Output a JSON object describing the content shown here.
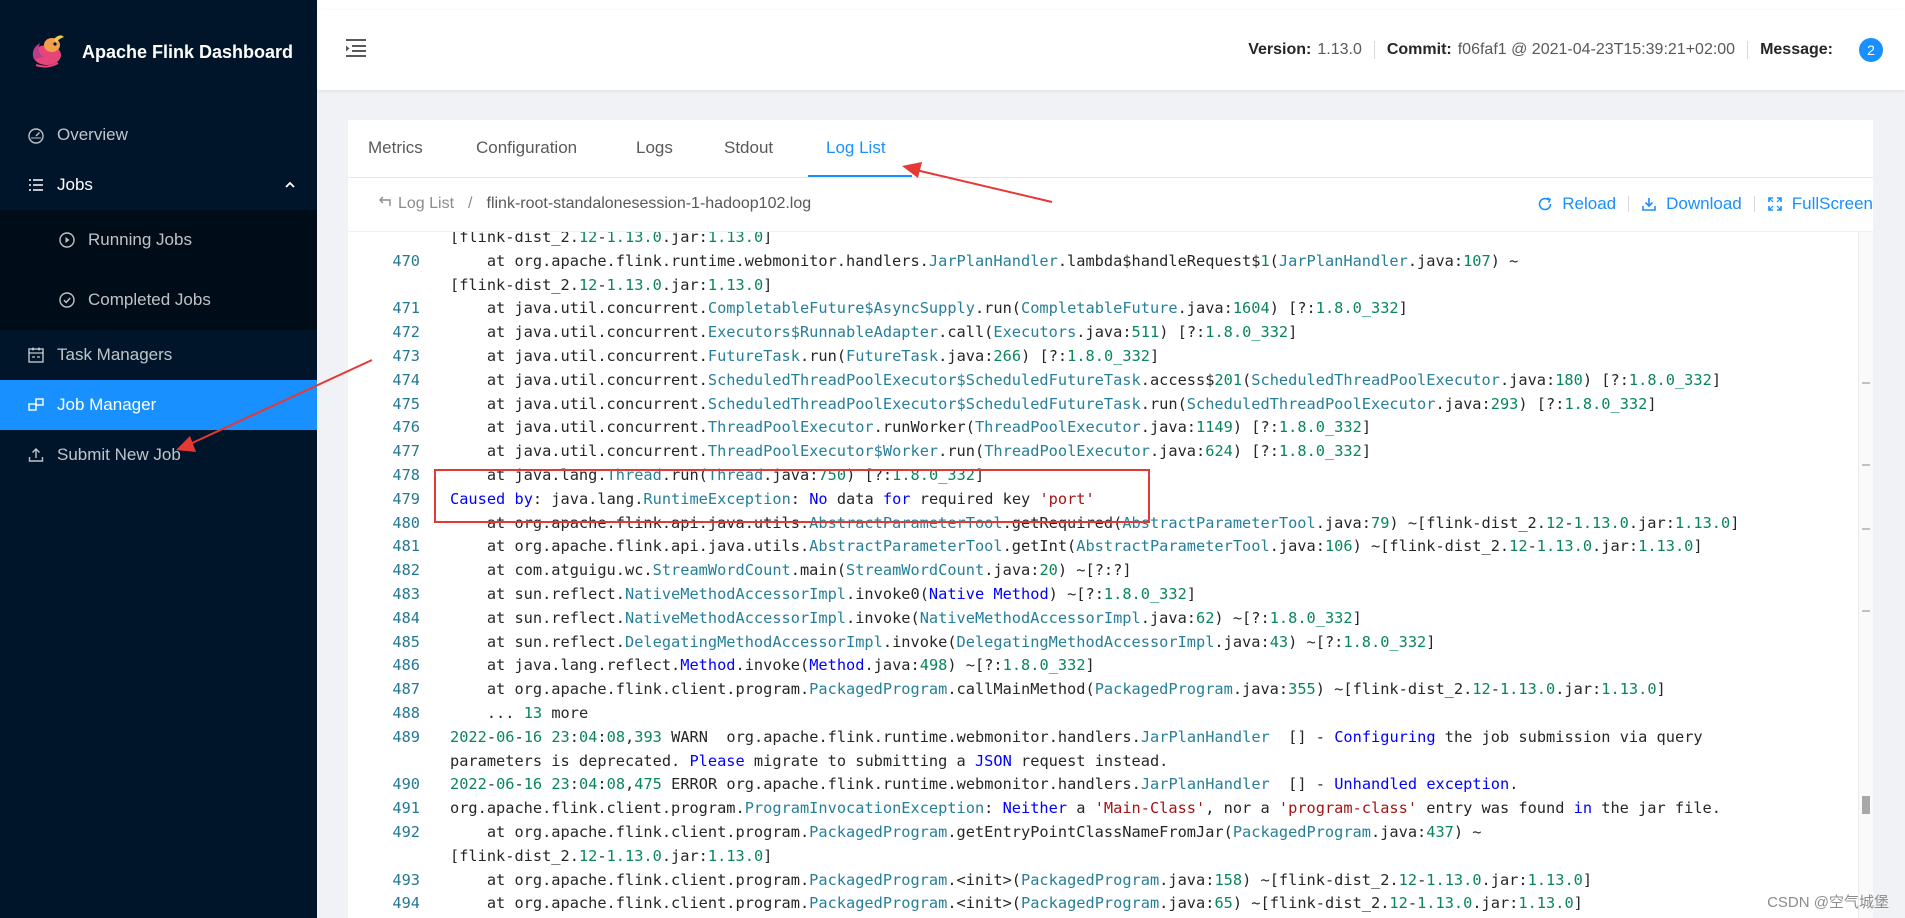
{
  "brand": {
    "title": "Apache Flink Dashboard"
  },
  "sidebar": {
    "items": [
      {
        "label": "Overview"
      },
      {
        "label": "Jobs"
      },
      {
        "label": "Running Jobs"
      },
      {
        "label": "Completed Jobs"
      },
      {
        "label": "Task Managers"
      },
      {
        "label": "Job Manager"
      },
      {
        "label": "Submit New Job"
      }
    ]
  },
  "header": {
    "version_label": "Version:",
    "version": "1.13.0",
    "commit_label": "Commit:",
    "commit": "f06faf1 @ 2021-04-23T15:39:21+02:00",
    "message_label": "Message:",
    "message_count": "2"
  },
  "tabs": [
    "Metrics",
    "Configuration",
    "Logs",
    "Stdout",
    "Log List"
  ],
  "breadcrumb": {
    "back": "Log List",
    "separator": "/",
    "current": "flink-root-standalonesession-1-hadoop102.log"
  },
  "actions": {
    "reload": "Reload",
    "download": "Download",
    "fullscreen": "FullScreen"
  },
  "log_lines": [
    {
      "n": "",
      "t": "[flink-dist_2.12-1.13.0.jar:1.13.0]"
    },
    {
      "n": "470",
      "t": "    at org.apache.flink.runtime.webmonitor.handlers.JarPlanHandler.lambda$handleRequest$1(JarPlanHandler.java:107) ~"
    },
    {
      "n": "",
      "t": "[flink-dist_2.12-1.13.0.jar:1.13.0]"
    },
    {
      "n": "471",
      "t": "    at java.util.concurrent.CompletableFuture$AsyncSupply.run(CompletableFuture.java:1604) [?:1.8.0_332]"
    },
    {
      "n": "472",
      "t": "    at java.util.concurrent.Executors$RunnableAdapter.call(Executors.java:511) [?:1.8.0_332]"
    },
    {
      "n": "473",
      "t": "    at java.util.concurrent.FutureTask.run(FutureTask.java:266) [?:1.8.0_332]"
    },
    {
      "n": "474",
      "t": "    at java.util.concurrent.ScheduledThreadPoolExecutor$ScheduledFutureTask.access$201(ScheduledThreadPoolExecutor.java:180) [?:1.8.0_332]"
    },
    {
      "n": "475",
      "t": "    at java.util.concurrent.ScheduledThreadPoolExecutor$ScheduledFutureTask.run(ScheduledThreadPoolExecutor.java:293) [?:1.8.0_332]"
    },
    {
      "n": "476",
      "t": "    at java.util.concurrent.ThreadPoolExecutor.runWorker(ThreadPoolExecutor.java:1149) [?:1.8.0_332]"
    },
    {
      "n": "477",
      "t": "    at java.util.concurrent.ThreadPoolExecutor$Worker.run(ThreadPoolExecutor.java:624) [?:1.8.0_332]"
    },
    {
      "n": "478",
      "t": "    at java.lang.Thread.run(Thread.java:750) [?:1.8.0_332]"
    },
    {
      "n": "479",
      "t": "Caused by: java.lang.RuntimeException: No data for required key 'port'"
    },
    {
      "n": "480",
      "t": "    at org.apache.flink.api.java.utils.AbstractParameterTool.getRequired(AbstractParameterTool.java:79) ~[flink-dist_2.12-1.13.0.jar:1.13.0]"
    },
    {
      "n": "481",
      "t": "    at org.apache.flink.api.java.utils.AbstractParameterTool.getInt(AbstractParameterTool.java:106) ~[flink-dist_2.12-1.13.0.jar:1.13.0]"
    },
    {
      "n": "482",
      "t": "    at com.atguigu.wc.StreamWordCount.main(StreamWordCount.java:20) ~[?:?]"
    },
    {
      "n": "483",
      "t": "    at sun.reflect.NativeMethodAccessorImpl.invoke0(Native Method) ~[?:1.8.0_332]"
    },
    {
      "n": "484",
      "t": "    at sun.reflect.NativeMethodAccessorImpl.invoke(NativeMethodAccessorImpl.java:62) ~[?:1.8.0_332]"
    },
    {
      "n": "485",
      "t": "    at sun.reflect.DelegatingMethodAccessorImpl.invoke(DelegatingMethodAccessorImpl.java:43) ~[?:1.8.0_332]"
    },
    {
      "n": "486",
      "t": "    at java.lang.reflect.Method.invoke(Method.java:498) ~[?:1.8.0_332]"
    },
    {
      "n": "487",
      "t": "    at org.apache.flink.client.program.PackagedProgram.callMainMethod(PackagedProgram.java:355) ~[flink-dist_2.12-1.13.0.jar:1.13.0]"
    },
    {
      "n": "488",
      "t": "    ... 13 more"
    },
    {
      "n": "489",
      "t": "2022-06-16 23:04:08,393 WARN  org.apache.flink.runtime.webmonitor.handlers.JarPlanHandler  [] - Configuring the job submission via query"
    },
    {
      "n": "",
      "t": "parameters is deprecated. Please migrate to submitting a JSON request instead."
    },
    {
      "n": "490",
      "t": "2022-06-16 23:04:08,475 ERROR org.apache.flink.runtime.webmonitor.handlers.JarPlanHandler  [] - Unhandled exception."
    },
    {
      "n": "491",
      "t": "org.apache.flink.client.program.ProgramInvocationException: Neither a 'Main-Class', nor a 'program-class' entry was found in the jar file."
    },
    {
      "n": "492",
      "t": "    at org.apache.flink.client.program.PackagedProgram.getEntryPointClassNameFromJar(PackagedProgram.java:437) ~"
    },
    {
      "n": "",
      "t": "[flink-dist_2.12-1.13.0.jar:1.13.0]"
    },
    {
      "n": "493",
      "t": "    at org.apache.flink.client.program.PackagedProgram.<init>(PackagedProgram.java:158) ~[flink-dist_2.12-1.13.0.jar:1.13.0]"
    },
    {
      "n": "494",
      "t": "    at org.apache.flink.client.program.PackagedProgram.<init>(PackagedProgram.java:65) ~[flink-dist_2.12-1.13.0.jar:1.13.0]"
    }
  ],
  "watermark": "CSDN @空气城堡",
  "colors": {
    "sidebar_bg": "#001529",
    "accent": "#1890ff",
    "annotation_red": "#e53935"
  }
}
